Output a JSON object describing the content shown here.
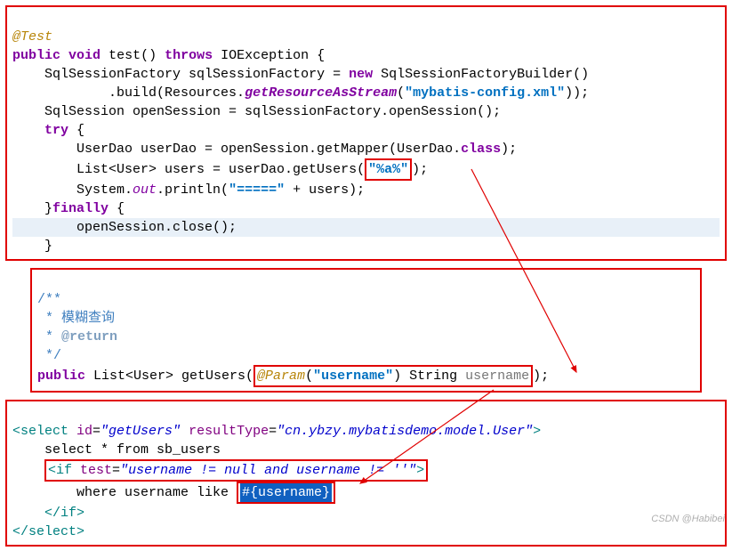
{
  "block1": {
    "l1_annotation": "@Test",
    "l2_a": "public",
    "l2_b": "void",
    "l2_c": "test()",
    "l2_d": "throws",
    "l2_e": "IOException {",
    "l3_a": "SqlSessionFactory sqlSessionFactory =",
    "l3_b": "new",
    "l3_c": "SqlSessionFactoryBuilder()",
    "l4_a": ".build(Resources.",
    "l4_b": "getResourceAsStream",
    "l4_c": "(",
    "l4_d": "\"mybatis-config.xml\"",
    "l4_e": "));",
    "l5": "SqlSession openSession = sqlSessionFactory.openSession();",
    "l6_a": "try",
    "l6_b": " {",
    "l7_a": "UserDao userDao = openSession.getMapper(UserDao.",
    "l7_b": "class",
    "l7_c": ");",
    "l8_a": "List<User> users = userDao.getUsers(",
    "l8_b": "\"%a%\"",
    "l8_c": ");",
    "l9_a": "System.",
    "l9_b": "out",
    "l9_c": ".println(",
    "l9_d": "\"=====\"",
    "l9_e": " + users);",
    "l10_a": "}",
    "l10_b": "finally",
    "l10_c": " {",
    "l11": "openSession.close();",
    "l12": "}"
  },
  "block2": {
    "c1": "/**",
    "c2": " * ",
    "c2_cn": "模糊查询",
    "c3_a": " * ",
    "c3_b": "@return",
    "c4": " */",
    "l1_a": "public",
    "l1_b": " List<User> getUsers(",
    "l1_c": "@Param",
    "l1_d": "(",
    "l1_e": "\"username\"",
    "l1_f": ") String ",
    "l1_g": "username",
    "l1_h": ");"
  },
  "block3": {
    "l1_a": "<select",
    "l1_b": " id",
    "l1_c": "=",
    "l1_d": "\"getUsers\"",
    "l1_e": " resultType",
    "l1_f": "=",
    "l1_g": "\"cn.ybzy.mybatisdemo.model.User\"",
    "l1_h": ">",
    "l2": "select * from sb_users",
    "l3_a": "<if",
    "l3_b": " test",
    "l3_c": "=",
    "l3_d": "\"username != null and username != ''\"",
    "l3_e": ">",
    "l4_a": "where username like ",
    "l4_b": "#{username}",
    "l5": "</if>",
    "l6": "</select>"
  },
  "watermark": "CSDN @Habibei"
}
